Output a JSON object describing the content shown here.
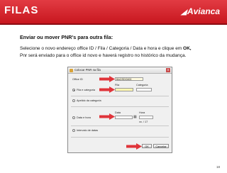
{
  "header": {
    "left_logo": "FILAS",
    "right_logo": "Avianca"
  },
  "title": "Enviar ou mover PNR's para outra fila:",
  "instructions": {
    "line1_pre": "Selecione o novo endereço office ID / Fila / Categoria / Data e hora e clique em ",
    "line1_bold": "OK,",
    "line2": "Pnr será enviado para o office id novo e haverá registro no histórico da mudança."
  },
  "dialog": {
    "title": "Colocar PNR na fila",
    "office_id_label": "Office ID",
    "office_id_value": "BAOSDO400",
    "fila_label": "Fila",
    "categoria_label": "Categoria",
    "radio1": "Fila e categoria",
    "radio2": "Apelido da categoria",
    "data_label": "Data",
    "hora_label": "Hora",
    "hora_value": "xx. / 17",
    "radio3": "Data e hora",
    "radio4": "Intervalo de datas",
    "ok": "OK",
    "cancel": "Cancelar"
  },
  "page_number": "18",
  "colors": {
    "header_red": "#d42a32",
    "arrow_red": "#e0343a",
    "highlight_yellow": "#fff7b0"
  }
}
